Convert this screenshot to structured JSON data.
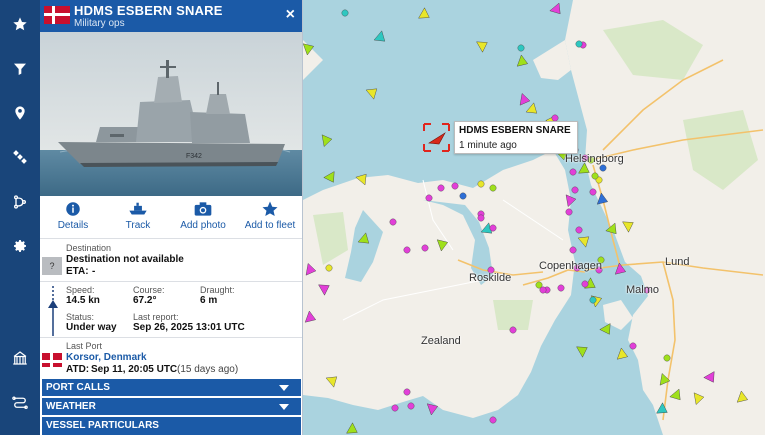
{
  "sidebar": {
    "icons": [
      "star-icon",
      "filter-icon",
      "location-pin-icon",
      "satellite-icon",
      "route-icon",
      "gear-icon",
      "port-icon",
      "route-planner-icon"
    ]
  },
  "vessel": {
    "name": "HDMS ESBERN SNARE",
    "type": "Military ops",
    "flag_colors": {
      "red": "#c8102e",
      "white": "#ffffff"
    },
    "hull_number": "F342"
  },
  "actions": [
    {
      "label": "Details",
      "icon": "info-icon"
    },
    {
      "label": "Track",
      "icon": "track-ship-icon"
    },
    {
      "label": "Add photo",
      "icon": "camera-icon"
    },
    {
      "label": "Add to fleet",
      "icon": "star-icon"
    }
  ],
  "destination": {
    "label": "Destination",
    "value": "Destination not available",
    "eta_label": "ETA:",
    "eta_value": "-",
    "icon_text": "?"
  },
  "voyage": {
    "speed_label": "Speed:",
    "speed_value": "14.5 kn",
    "course_label": "Course:",
    "course_value": "67.2°",
    "draught_label": "Draught:",
    "draught_value": "6 m",
    "status_label": "Status:",
    "status_value": "Under way",
    "last_report_label": "Last report:",
    "last_report_value": "Sep 26, 2025 13:01 UTC"
  },
  "last_port": {
    "label": "Last Port",
    "port": "Korsor, Denmark",
    "atd_label": "ATD:",
    "atd_value": "Sep 11, 20:05 UTC",
    "atd_ago": "(15 days ago)"
  },
  "sections": [
    "PORT CALLS",
    "WEATHER",
    "VESSEL PARTICULARS"
  ],
  "map": {
    "tooltip_name": "HDMS ESBERN SNARE",
    "tooltip_time": "1 minute ago",
    "places": [
      "Helsingborg",
      "Copenhagen",
      "Roskilde",
      "Zealand",
      "Lund",
      "Malmo"
    ],
    "colors": {
      "sea": "#aad3df",
      "land": "#f2efe9",
      "forest": "#cfe3bf",
      "cargo": "#9fe01b",
      "tanker": "#e8e62a",
      "passenger": "#2e6fd6",
      "pleasure": "#e23fd8",
      "other": "#2ec7c0"
    }
  },
  "close_label": "×"
}
